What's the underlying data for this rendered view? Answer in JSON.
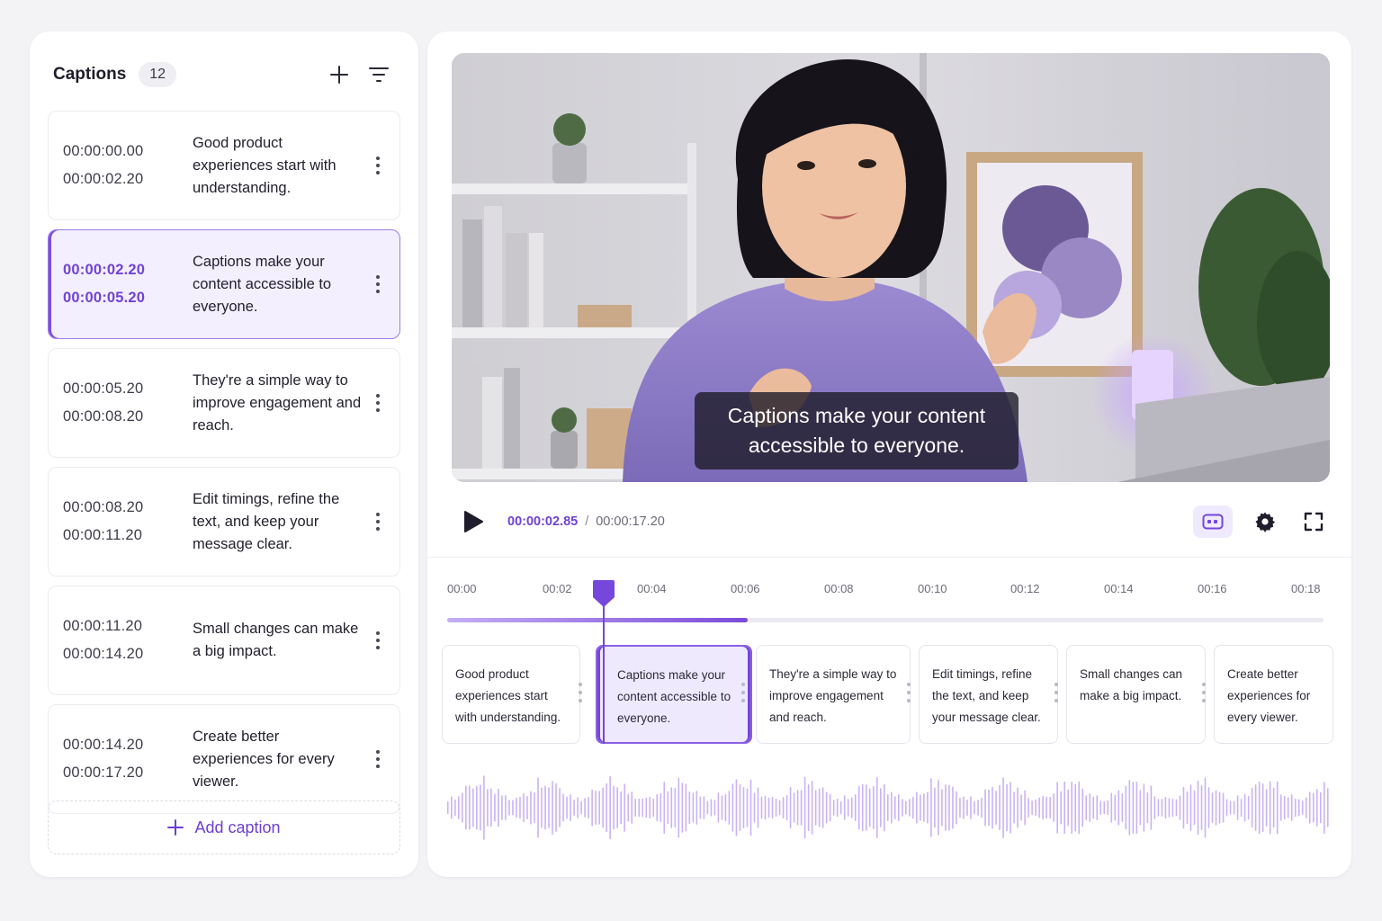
{
  "sidebar": {
    "title": "Captions",
    "count": "12",
    "add_icon": "plus-icon",
    "filter_icon": "filter-icon",
    "items": [
      {
        "start": "00:00:00.00",
        "end": "00:00:02.20",
        "text": "Good product experiences start with understanding."
      },
      {
        "start": "00:00:02.20",
        "end": "00:00:05.20",
        "text": "Captions make your content accessible to everyone.",
        "active": true
      },
      {
        "start": "00:00:05.20",
        "end": "00:00:08.20",
        "text": "They're a simple way to improve engagement and reach."
      },
      {
        "start": "00:00:08.20",
        "end": "00:00:11.20",
        "text": "Edit timings, refine the text, and keep your message clear."
      },
      {
        "start": "00:00:11.20",
        "end": "00:00:14.20",
        "text": "Small changes can make a big impact."
      },
      {
        "start": "00:00:14.20",
        "end": "00:00:17.20",
        "text": "Create better experiences for every viewer."
      }
    ],
    "add_label": "Add caption"
  },
  "player": {
    "overlay_caption": "Captions make your content accessible to everyone.",
    "current_time": "00:00:02.85",
    "separator": "/",
    "total_time": "00:00:17.20",
    "icons": [
      "play-icon",
      "captions-icon",
      "gear-icon",
      "fullscreen-icon"
    ]
  },
  "timeline": {
    "ticks": [
      "00:00",
      "00:02",
      "00:04",
      "00:06",
      "00:08",
      "00:10",
      "00:12",
      "00:14",
      "00:16",
      "00:18"
    ],
    "progress_fraction": 0.343,
    "playhead_seconds": 2.85,
    "segments": [
      {
        "text": "Good product experiences start with understanding."
      },
      {
        "text": "Captions make your content accessible to everyone.",
        "active": true
      },
      {
        "text": "They're a simple way to improve engagement and reach."
      },
      {
        "text": "Edit timings, refine the text, and keep your message clear."
      },
      {
        "text": "Small changes can make a big impact."
      },
      {
        "text": "Create better experiences for every viewer."
      }
    ]
  },
  "colors": {
    "accent": "#7547da",
    "accent_light": "#efe9fe",
    "waveform": "#c9b3f3"
  }
}
